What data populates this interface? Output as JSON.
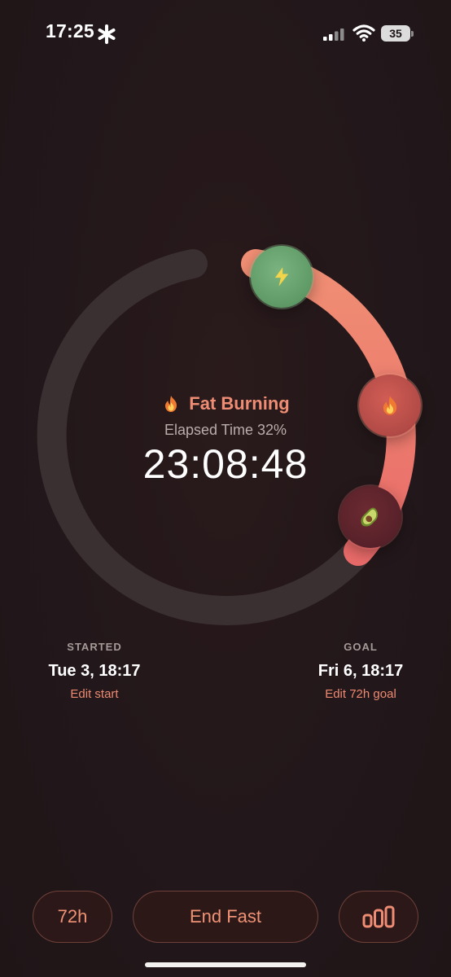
{
  "status_bar": {
    "time": "17:25",
    "battery_level": "35",
    "icons": [
      "asterisk-icon",
      "signal-icon",
      "wifi-icon",
      "battery-icon"
    ]
  },
  "tracker": {
    "stage_title": "Fat Burning",
    "stage_icon": "fire-icon",
    "elapsed_label": "Elapsed Time 32%",
    "elapsed_time": "23:08:48",
    "progress_fraction": 0.32,
    "markers": [
      {
        "name": "energy-stage",
        "icon": "lightning-icon"
      },
      {
        "name": "fat-burning-stage",
        "icon": "fire-icon"
      },
      {
        "name": "food-stage",
        "icon": "avocado-icon"
      }
    ]
  },
  "started": {
    "label": "STARTED",
    "value": "Tue 3, 18:17",
    "action": "Edit start"
  },
  "goal": {
    "label": "GOAL",
    "value": "Fri 6, 18:17",
    "action": "Edit 72h goal"
  },
  "controls": {
    "duration_label": "72h",
    "end_label": "End Fast",
    "stats_icon": "bar-chart-icon"
  },
  "colors": {
    "background": "#24171a",
    "accent": "#ef8d74",
    "track": "#3b3031",
    "progress_start": "#f08f74",
    "progress_end": "#e96b69",
    "energy_marker": "#5f9a66",
    "fire_marker": "#b24a46",
    "avocado_marker": "#57212a"
  }
}
